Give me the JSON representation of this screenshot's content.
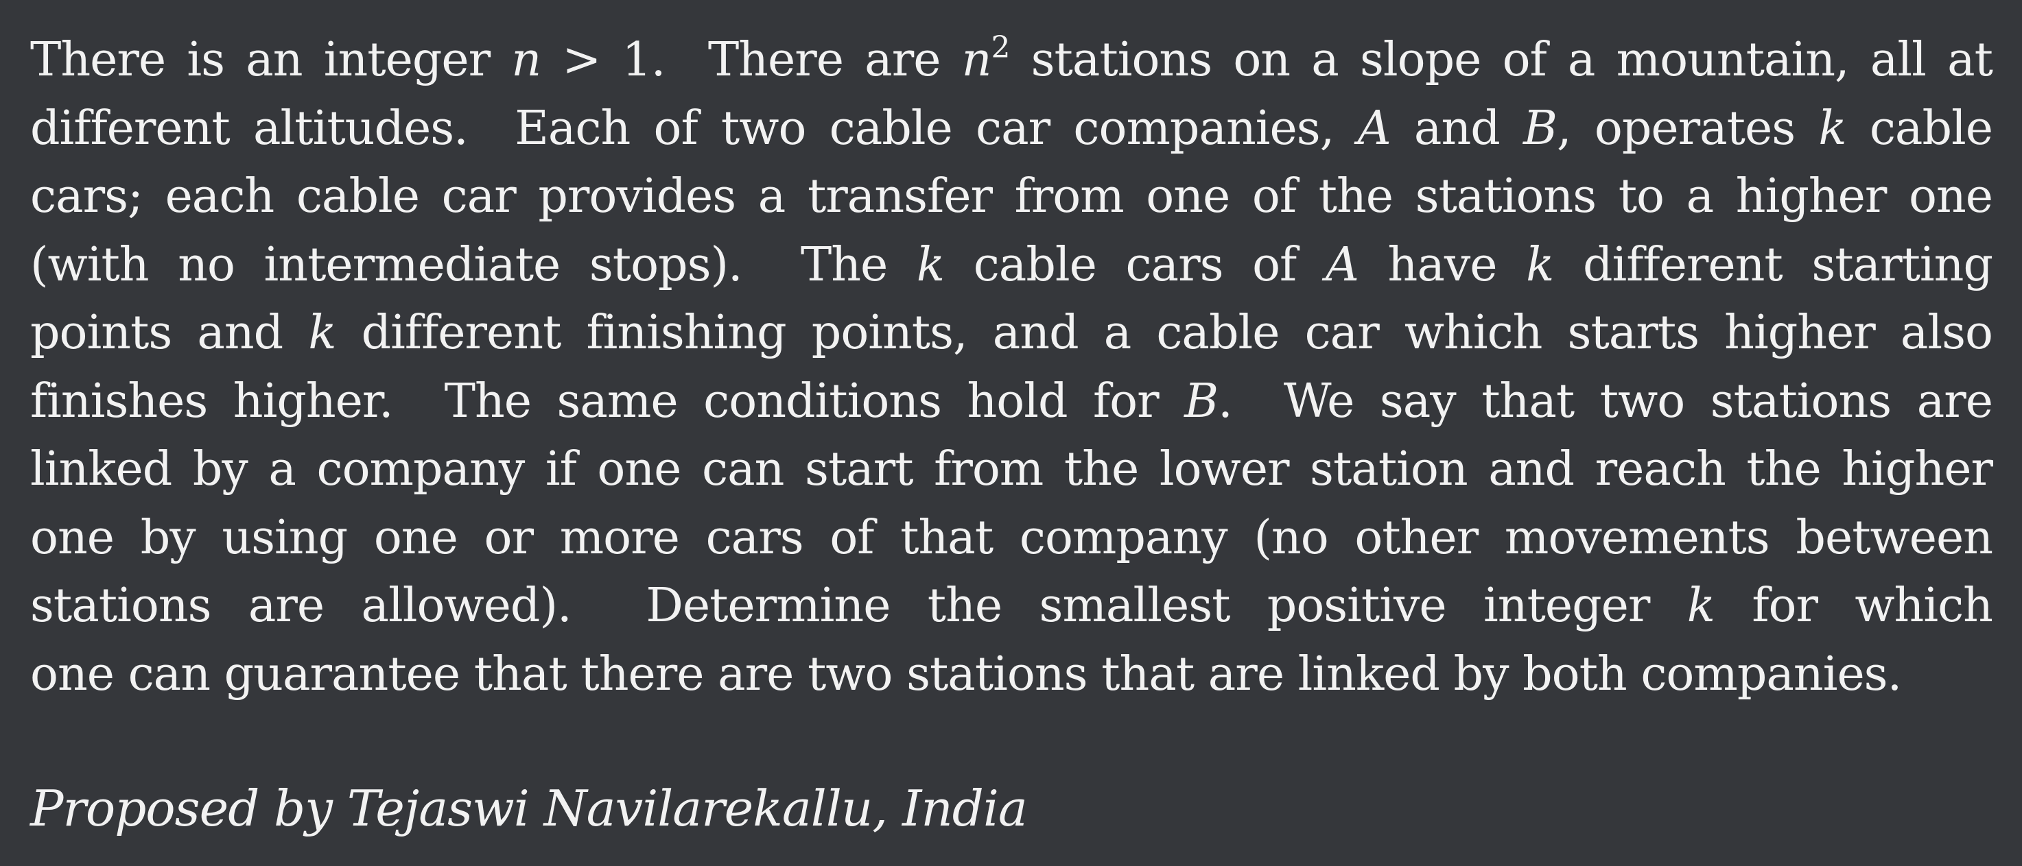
{
  "problem": {
    "line1": {
      "a": "There is an integer ",
      "b": "n",
      "c": " > 1.  There are ",
      "d": "n",
      "e": "2",
      "f": " stations on a slope of a mountain, all at"
    },
    "line2": {
      "a": "different altitudes.  Each of two cable car companies, ",
      "b": "A",
      "c": " and ",
      "d": "B",
      "e": ", operates ",
      "f": "k",
      "g": " cable"
    },
    "line3": "cars; each cable car provides a transfer from one of the stations to a higher one",
    "line4": {
      "a": "(with no intermediate stops).  The ",
      "b": "k",
      "c": " cable cars of ",
      "d": "A",
      "e": " have ",
      "f": "k",
      "g": " different starting"
    },
    "line5": {
      "a": "points and ",
      "b": "k",
      "c": " different finishing points, and a cable car which starts higher also"
    },
    "line6": {
      "a": "finishes higher.  The same conditions hold for ",
      "b": "B",
      "c": ".  We say that two stations are"
    },
    "line7": "linked by a company if one can start from the lower station and reach the higher",
    "line8": "one by using one or more cars of that company (no other movements between",
    "line9": {
      "a": "stations are allowed).  Determine the smallest positive integer ",
      "b": "k",
      "c": " for which"
    },
    "line10": "one can guarantee that there are two stations that are linked by both companies."
  },
  "byline": "Proposed by Tejaswi Navilarekallu, India"
}
